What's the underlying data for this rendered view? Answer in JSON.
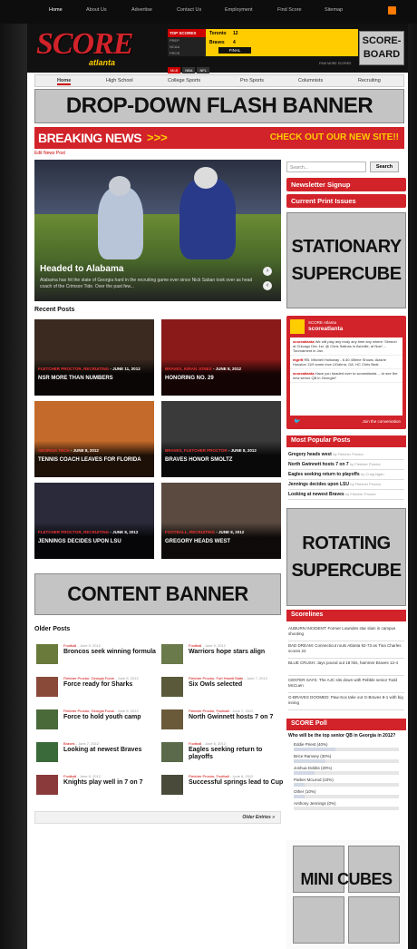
{
  "top_nav": [
    "Home",
    "About Us",
    "Advertise",
    "Contact Us",
    "Employment",
    "Find Score",
    "Sitemap"
  ],
  "logo": {
    "text": "SCORE",
    "sub": "atlanta"
  },
  "scoreboard": {
    "header": "TOP SCORES",
    "side_items": [
      "PREP",
      "NCAA",
      "PROS"
    ],
    "rows": [
      {
        "team": "Toronto",
        "score": "12"
      },
      {
        "team": "Braves",
        "score": "4"
      }
    ],
    "status": "FINAL",
    "tabs": [
      "MLB",
      "NBA",
      "NFL"
    ],
    "link": "FIND MORE SCORES",
    "placeholder": "SCORE-BOARD"
  },
  "main_nav": [
    "Home",
    "High School",
    "College Sports",
    "Pro Sports",
    "Columnists",
    "Recruiting"
  ],
  "banners": {
    "dropdown": "DROP-DOWN FLASH BANNER",
    "stationary": "STATIONARY SUPERCUBE",
    "rotating": "ROTATING SUPERCUBE",
    "content": "CONTENT BANNER",
    "mini": "MINI CUBES"
  },
  "breaking": {
    "label": "BREAKING NEWS",
    "arrows": ">>>",
    "right": "CHECK OUT OUR NEW SITE!!"
  },
  "edit_link": "Edit News Post",
  "hero": {
    "title": "Headed to Alabama",
    "desc": "Alabama has hit the state of Georgia hard in the recruiting game ever since Nick Saban took over as head coach of the Crimson Tide. Over the past few..."
  },
  "search": {
    "placeholder": "Search...",
    "button": "Search"
  },
  "side_buttons": [
    "Newsletter Signup",
    "Current Print Issues"
  ],
  "twitter": {
    "name": "SCORE Atlanta",
    "handle": "scoreatlanta",
    "tweets": [
      {
        "user": "scoreatlanta",
        "text": "We will play any body any time any where: Simeon at Chicago Dec 1st. @ Chris Salinas in Ashville, at Noel ... Tournament in Jan."
      },
      {
        "user": "mgrift",
        "text": "RB. Mitchell Holloway - 6.40 40time Shows. Alashe Houston 11/9 some love UGahna, GA. HC Chris Beal"
      },
      {
        "user": "scoreatlanta",
        "text": "Have you headed over to scoreatlanta ... to see the new senior QB in Georgia?"
      }
    ],
    "join": "Join the conversation"
  },
  "popular": {
    "title": "Most Popular Posts",
    "items": [
      {
        "title": "Gregory heads west",
        "by": "by Fletcher Proctor"
      },
      {
        "title": "North Gwinnett hosts 7 on 7",
        "by": "by Fletcher Proctor"
      },
      {
        "title": "Eagles seeking return to playoffs",
        "by": "by Craig Ngan"
      },
      {
        "title": "Jennings decides upon LSU",
        "by": "by Fletcher Proctor"
      },
      {
        "title": "Looking at newest Braves",
        "by": "by Fletcher Proctor"
      }
    ]
  },
  "scorelines": {
    "title": "Scorelines",
    "items": [
      "AUBURN INCIDENT: Former Lowndes star slain in campus shooting",
      "BAD DREAM: Connecticut routs Atlanta 92-73 as Tina Charles scores 22",
      "BLUE CRUSH: Jays pound out 18 hits, hammer Braves 12-4",
      "CENTER SAYS: The AJC sits down with Pebble senior Todd McCuen",
      "G-BRAVES DOOMED: Paw-Sox take out G-Braves 8-1 with big inning"
    ]
  },
  "poll": {
    "title": "SCORE Poll",
    "question": "Who will be the top senior QB in Georgia in 2012?",
    "options": [
      {
        "label": "Eddie Priest (40%)",
        "pct": 40
      },
      {
        "label": "Brice Ramsey (30%)",
        "pct": 30
      },
      {
        "label": "Joshua Dobbs (20%)",
        "pct": 20
      },
      {
        "label": "Parker McLeod (10%)",
        "pct": 10
      },
      {
        "label": "Other (10%)",
        "pct": 10
      },
      {
        "label": "Anthony Jennings (0%)",
        "pct": 0
      }
    ]
  },
  "recent": {
    "title": "Recent Posts",
    "cards": [
      {
        "cat": "FLETCHER PROCTOR, RECRUITING",
        "date": " - JUNE 11, 2012",
        "title": "NSR MORE THAN NUMBERS",
        "color": "#3a2a20"
      },
      {
        "cat": "BRAVES, KIRAN JONES",
        "date": " - JUNE 8, 2012",
        "title": "HONORING NO. 29",
        "color": "#8a1a1a"
      },
      {
        "cat": "GEORGIA TECH",
        "date": " - JUNE 8, 2012",
        "title": "TENNIS COACH LEAVES FOR FLORIDA",
        "color": "#c46a2a"
      },
      {
        "cat": "BRAVES, FLETCHER PROCTOR",
        "date": " - JUNE 8, 2012",
        "title": "BRAVES HONOR SMOLTZ",
        "color": "#3a3a3a"
      },
      {
        "cat": "FLETCHER PROCTOR, RECRUITING",
        "date": " - JUNE 8, 2012",
        "title": "JENNINGS DECIDES UPON LSU",
        "color": "#2a2a3a"
      },
      {
        "cat": "FOOTBALL, RECRUITING",
        "date": " - JUNE 8, 2012",
        "title": "GREGORY HEADS WEST",
        "color": "#5a4a40"
      }
    ]
  },
  "older": {
    "title": "Older Posts",
    "posts": [
      {
        "cat": "Football",
        "date": " - June 9, 2012",
        "title": "Broncos seek winning formula",
        "color": "#6a7a3a"
      },
      {
        "cat": "Football",
        "date": " - June 9, 2012",
        "title": "Warriors hope stars align",
        "color": "#6a7a4a"
      },
      {
        "cat": "Fletcher Proctor, Georgia Force",
        "date": " - June 8, 2012",
        "title": "Force ready for Sharks",
        "color": "#8a4a3a"
      },
      {
        "cat": "Fletcher Proctor, Fort Hewitt State",
        "date": " - June 7, 2012",
        "title": "Six Owls selected",
        "color": "#5a5a3a"
      },
      {
        "cat": "Fletcher Proctor, Georgia Force",
        "date": " - June 8, 2012",
        "title": "Force to hold youth camp",
        "color": "#4a6a3a"
      },
      {
        "cat": "Fletcher Proctor, Football",
        "date": " - June 7, 2012",
        "title": "North Gwinnett hosts 7 on 7",
        "color": "#6a5a3a"
      },
      {
        "cat": "Braves",
        "date": " - June 7, 2012",
        "title": "Looking at newest Braves",
        "color": "#3a6a3a"
      },
      {
        "cat": "Football",
        "date": " - June 6, 2012",
        "title": "Eagles seeking return to playoffs",
        "color": "#5a6a4a"
      },
      {
        "cat": "Football",
        "date": " - June 6, 2012",
        "title": "Knights play well in 7 on 7",
        "color": "#8a3a3a"
      },
      {
        "cat": "Fletcher Proctor, Football",
        "date": " - June 6, 2012",
        "title": "Successful springs lead to Cup",
        "color": "#4a4a3a"
      }
    ],
    "more": "Older Entries »"
  }
}
